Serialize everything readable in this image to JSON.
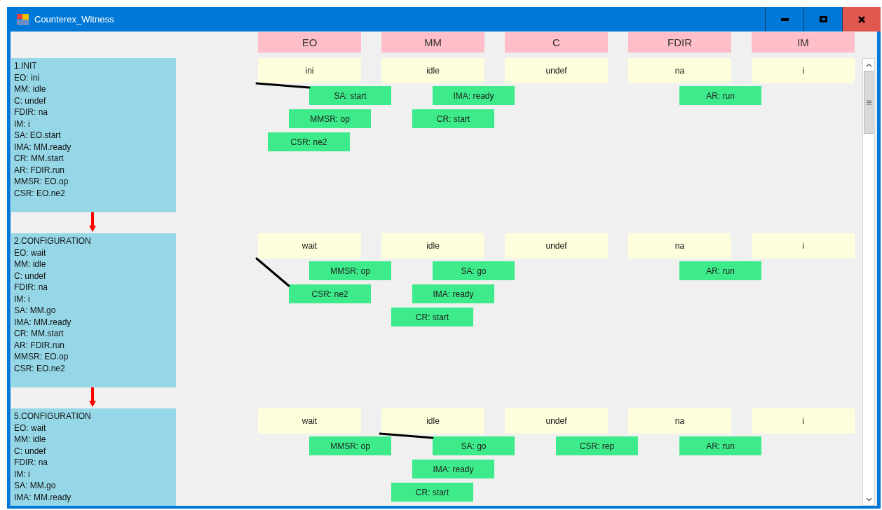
{
  "window": {
    "title": "Counterex_Witness"
  },
  "columns": [
    "EO",
    "MM",
    "C",
    "FDIR",
    "IM"
  ],
  "steps": [
    {
      "title": "1.INIT",
      "lines": [
        "EO: ini",
        "MM: idle",
        "C: undef",
        "FDIR: na",
        "IM: i",
        "SA: EO.start",
        "IMA: MM.ready",
        "CR: MM.start",
        "AR: FDIR.run",
        "MMSR: EO.op",
        "CSR: EO.ne2"
      ],
      "cells": [
        {
          "value": "ini",
          "labels": [
            {
              "text": "SA: start",
              "linked": true
            },
            {
              "text": "MMSR: op",
              "linked": false
            },
            {
              "text": "CSR: ne2",
              "linked": false
            }
          ]
        },
        {
          "value": "idle",
          "labels": [
            {
              "text": "IMA: ready",
              "linked": false
            },
            {
              "text": "CR: start",
              "linked": false
            }
          ]
        },
        {
          "value": "undef"
        },
        {
          "value": "na",
          "labels": [
            {
              "text": "AR: run",
              "linked": false
            }
          ]
        },
        {
          "value": "i"
        }
      ]
    },
    {
      "title": "2.CONFIGURATION",
      "lines": [
        "EO: wait",
        "MM: idle",
        "C: undef",
        "FDIR: na",
        "IM: i",
        "SA: MM.go",
        "IMA: MM.ready",
        "CR: MM.start",
        "AR: FDIR.run",
        "MMSR: EO.op",
        "CSR: EO.ne2"
      ],
      "cells": [
        {
          "value": "wait",
          "labels": [
            {
              "text": "MMSR: op",
              "linked": false
            },
            {
              "text": "CSR: ne2",
              "linked": true
            }
          ]
        },
        {
          "value": "idle",
          "labels": [
            {
              "text": "SA: go",
              "linked": false
            },
            {
              "text": "IMA: ready",
              "linked": false
            },
            {
              "text": "CR: start",
              "linked": false
            }
          ]
        },
        {
          "value": "undef"
        },
        {
          "value": "na",
          "labels": [
            {
              "text": "AR: run",
              "linked": false
            }
          ]
        },
        {
          "value": "i"
        }
      ]
    },
    {
      "title": "5.CONFIGURATION",
      "lines": [
        "EO: wait",
        "MM: idle",
        "C: undef",
        "FDIR: na",
        "IM: i",
        "SA: MM.go",
        "IMA: MM.ready"
      ],
      "cells": [
        {
          "value": "wait",
          "labels": [
            {
              "text": "MMSR: op",
              "linked": false
            }
          ]
        },
        {
          "value": "idle",
          "labels": [
            {
              "text": "SA: go",
              "linked": true
            },
            {
              "text": "IMA: ready",
              "linked": false
            },
            {
              "text": "CR: start",
              "linked": false
            }
          ]
        },
        {
          "value": "undef",
          "labels": [
            {
              "text": "CSR: rep",
              "linked": false
            }
          ]
        },
        {
          "value": "na",
          "labels": [
            {
              "text": "AR: run",
              "linked": false
            }
          ]
        },
        {
          "value": "i"
        }
      ]
    }
  ]
}
